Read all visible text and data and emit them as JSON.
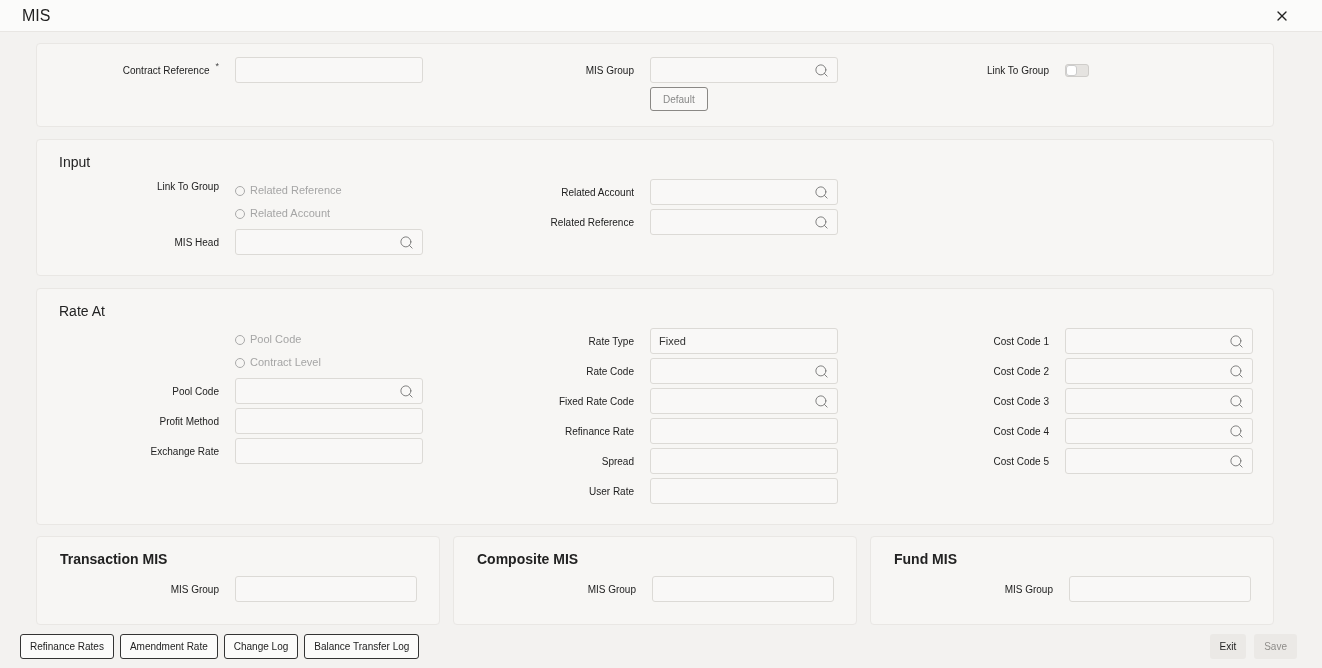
{
  "title": "MIS",
  "top": {
    "columns": [
      [
        {
          "kind": "text",
          "label": "Contract Reference",
          "required_mark": "*"
        }
      ],
      [
        {
          "kind": "lookup",
          "label": "MIS Group"
        },
        {
          "kind": "button",
          "label": "Default",
          "disabled": false
        }
      ],
      [
        {
          "kind": "toggle",
          "label": "Link To Group",
          "on": false
        }
      ]
    ]
  },
  "sections": [
    {
      "title": "Input",
      "columns": [
        [
          {
            "kind": "radio",
            "label": "Link To Group",
            "options": [
              {
                "label": "Related Reference",
                "selected": false,
                "disabled": true
              },
              {
                "label": "Related Account",
                "selected": false,
                "disabled": true
              }
            ]
          },
          {
            "kind": "lookup",
            "label": "MIS Head"
          }
        ],
        [
          {
            "kind": "lookup",
            "label": "Related Account"
          },
          {
            "kind": "lookup",
            "label": "Related Reference"
          }
        ]
      ]
    },
    {
      "title": "Rate At",
      "columns": [
        [
          {
            "kind": "radio",
            "options": [
              {
                "label": "Pool Code",
                "selected": false,
                "disabled": true
              },
              {
                "label": "Contract Level",
                "selected": false,
                "disabled": true
              }
            ]
          },
          {
            "kind": "lookup",
            "label": "Pool Code"
          },
          {
            "kind": "text",
            "label": "Profit Method"
          },
          {
            "kind": "text",
            "label": "Exchange Rate"
          }
        ],
        [
          {
            "kind": "text",
            "label": "Rate Type",
            "value": "Fixed"
          },
          {
            "kind": "lookup",
            "label": "Rate Code"
          },
          {
            "kind": "lookup",
            "label": "Fixed Rate Code"
          },
          {
            "kind": "text",
            "label": "Refinance Rate"
          },
          {
            "kind": "text",
            "label": "Spread"
          },
          {
            "kind": "text",
            "label": "User Rate"
          }
        ],
        [
          {
            "kind": "lookup",
            "label": "Cost Code 1"
          },
          {
            "kind": "lookup",
            "label": "Cost Code 2"
          },
          {
            "kind": "lookup",
            "label": "Cost Code 3"
          },
          {
            "kind": "lookup",
            "label": "Cost Code 4"
          },
          {
            "kind": "lookup",
            "label": "Cost Code 5"
          }
        ]
      ]
    }
  ],
  "mis_panels": [
    {
      "title": "Transaction MIS",
      "label": "MIS Group"
    },
    {
      "title": "Composite MIS",
      "label": "MIS Group"
    },
    {
      "title": "Fund MIS",
      "label": "MIS Group"
    }
  ],
  "footer_left": [
    {
      "label": "Refinance Rates",
      "disabled": false
    },
    {
      "label": "Amendment Rate",
      "disabled": false
    },
    {
      "label": "Change Log",
      "disabled": false
    },
    {
      "label": "Balance Transfer Log",
      "disabled": false
    }
  ],
  "footer_right": [
    {
      "label": "Exit",
      "disabled": false
    },
    {
      "label": "Save",
      "disabled": true
    }
  ]
}
